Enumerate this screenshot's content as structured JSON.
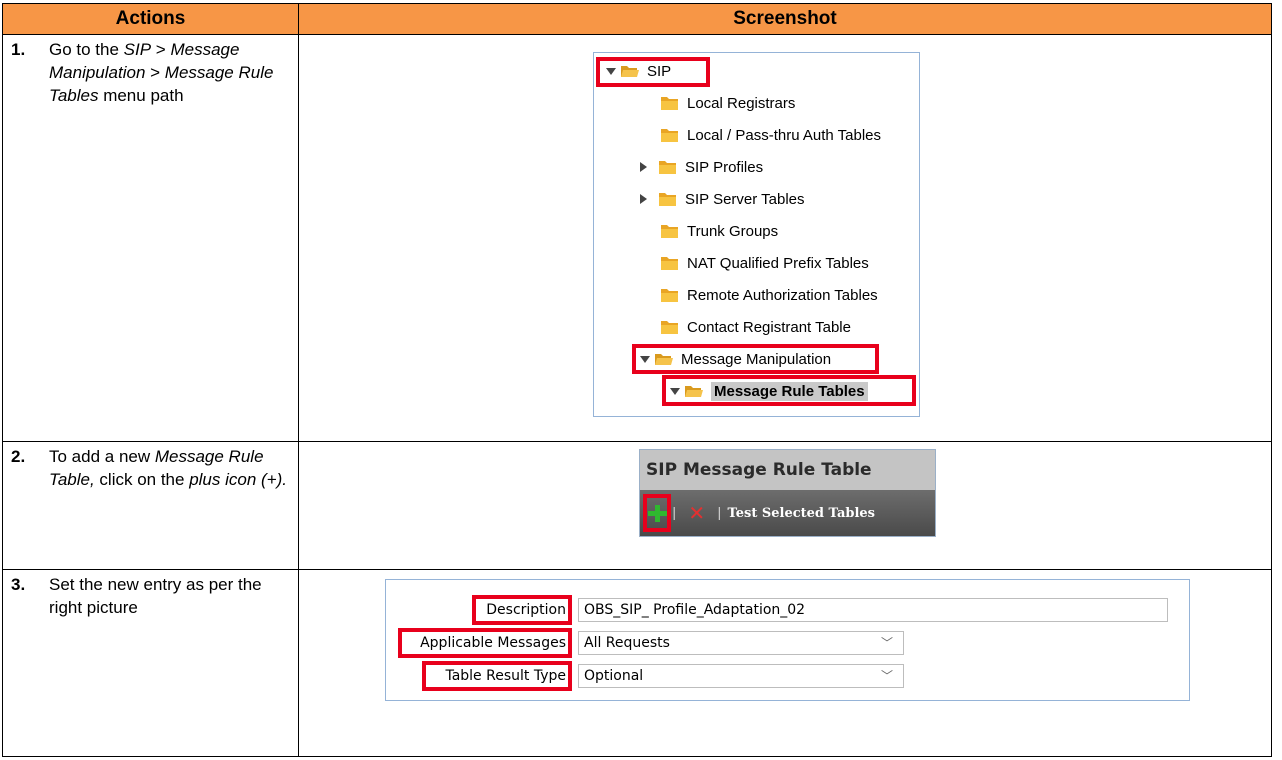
{
  "headers": {
    "actions": "Actions",
    "screenshot": "Screenshot"
  },
  "steps": [
    {
      "num": "1.",
      "text_html": "Go to the <i>SIP</i> &gt; <i>Message Manipulation</i> &gt; <i>Message Rule Tables</i> menu path"
    },
    {
      "num": "2.",
      "text_html": "To add a new <i>Message Rule Table,</i> click on the <i>plus icon (+).</i>"
    },
    {
      "num": "3.",
      "text_html": "Set the new entry as per the right picture"
    }
  ],
  "tree": {
    "root": "SIP",
    "items": [
      "Local Registrars",
      "Local / Pass-thru Auth Tables",
      "SIP Profiles",
      "SIP Server Tables",
      "Trunk Groups",
      "NAT Qualified Prefix Tables",
      "Remote Authorization Tables",
      "Contact Registrant Table",
      "Message Manipulation",
      "Message Rule Tables"
    ]
  },
  "rule_table": {
    "title": "SIP Message Rule Table",
    "test_label": "Test Selected Tables",
    "plus_icon": "plus-icon",
    "delete_icon": "delete-x-icon",
    "sep": "|"
  },
  "form": {
    "description_label": "Description",
    "description_value": "OBS_SIP_ Profile_Adaptation_02",
    "applicable_label": "Applicable Messages",
    "applicable_value": "All Requests",
    "result_label": "Table Result Type",
    "result_value": "Optional"
  },
  "colors": {
    "header_bg": "#f79646",
    "highlight": "#e8001c"
  }
}
